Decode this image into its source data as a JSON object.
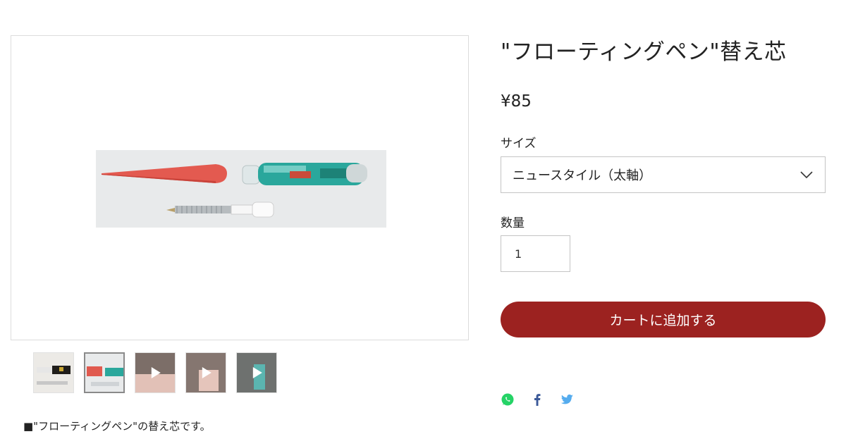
{
  "product": {
    "title": "\"フローティングペン\"替え芯",
    "price": "¥85",
    "size_label": "サイズ",
    "size_selected": "ニュースタイル（太軸）",
    "qty_label": "数量",
    "qty_value": "1",
    "cart_button": "カートに追加する",
    "description": "■\"フローティングペン\"の替え芯です。"
  },
  "gallery": {
    "thumbnails": [
      {
        "kind": "image",
        "selected": false
      },
      {
        "kind": "image",
        "selected": true
      },
      {
        "kind": "video",
        "selected": false
      },
      {
        "kind": "video",
        "selected": false
      },
      {
        "kind": "video",
        "selected": false
      }
    ]
  },
  "share": {
    "icons": [
      "whatsapp-icon",
      "facebook-icon",
      "twitter-icon"
    ]
  },
  "colors": {
    "accent": "#9c2220",
    "whatsapp": "#25d366",
    "facebook": "#3b5998",
    "twitter": "#55acee"
  }
}
